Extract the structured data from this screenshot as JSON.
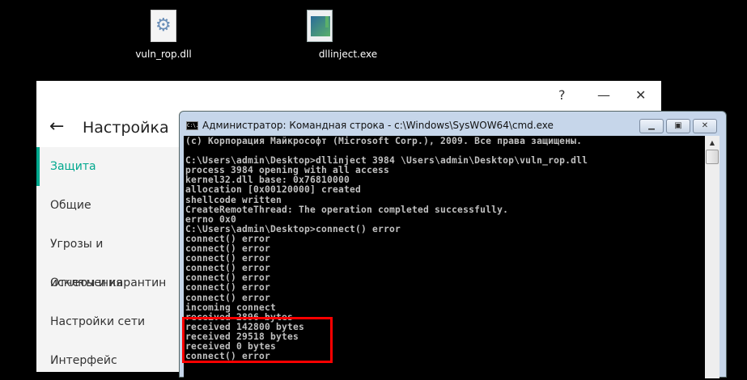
{
  "desktop": {
    "icons": [
      {
        "label": "vuln_rop.dll",
        "icon": "dll-gear-icon"
      },
      {
        "label": "dllinject.exe",
        "icon": "exe-window-icon"
      }
    ]
  },
  "settings": {
    "title": "Настройка",
    "help": "?",
    "minimize": "—",
    "close": "✕",
    "back": "←",
    "sidebar": [
      {
        "label": "Защита",
        "active": true
      },
      {
        "label": "Общие"
      },
      {
        "label": "Угрозы и исключения"
      },
      {
        "label": "Отчеты и карантин"
      },
      {
        "label": "Настройки сети"
      },
      {
        "label": "Интерфейс"
      }
    ],
    "accent": "#00a88e"
  },
  "cmd": {
    "title": "Администратор: Командная строка - c:\\Windows\\SysWOW64\\cmd.exe",
    "icon_text": "C:\\.",
    "lines": [
      "(c) Корпорация Майкрософт (Microsoft Corp.), 2009. Все права защищены.",
      "",
      "C:\\Users\\admin\\Desktop>dllinject 3984 \\Users\\admin\\Desktop\\vuln_rop.dll",
      "process 3984 opening with all access",
      "kernel32.dll base: 0x76810000",
      "allocation [0x00120000] created",
      "shellcode written",
      "CreateRemoteThread: The operation completed successfully.",
      "errno 0x0",
      "C:\\Users\\admin\\Desktop>connect() error",
      "connect() error",
      "connect() error",
      "connect() error",
      "connect() error",
      "connect() error",
      "connect() error",
      "connect() error",
      "incoming connect",
      "received 2896 bytes",
      "received 142800 bytes",
      "received 29518 bytes",
      "received 0 bytes",
      "connect() error"
    ],
    "highlight_color": "#ff0000"
  }
}
